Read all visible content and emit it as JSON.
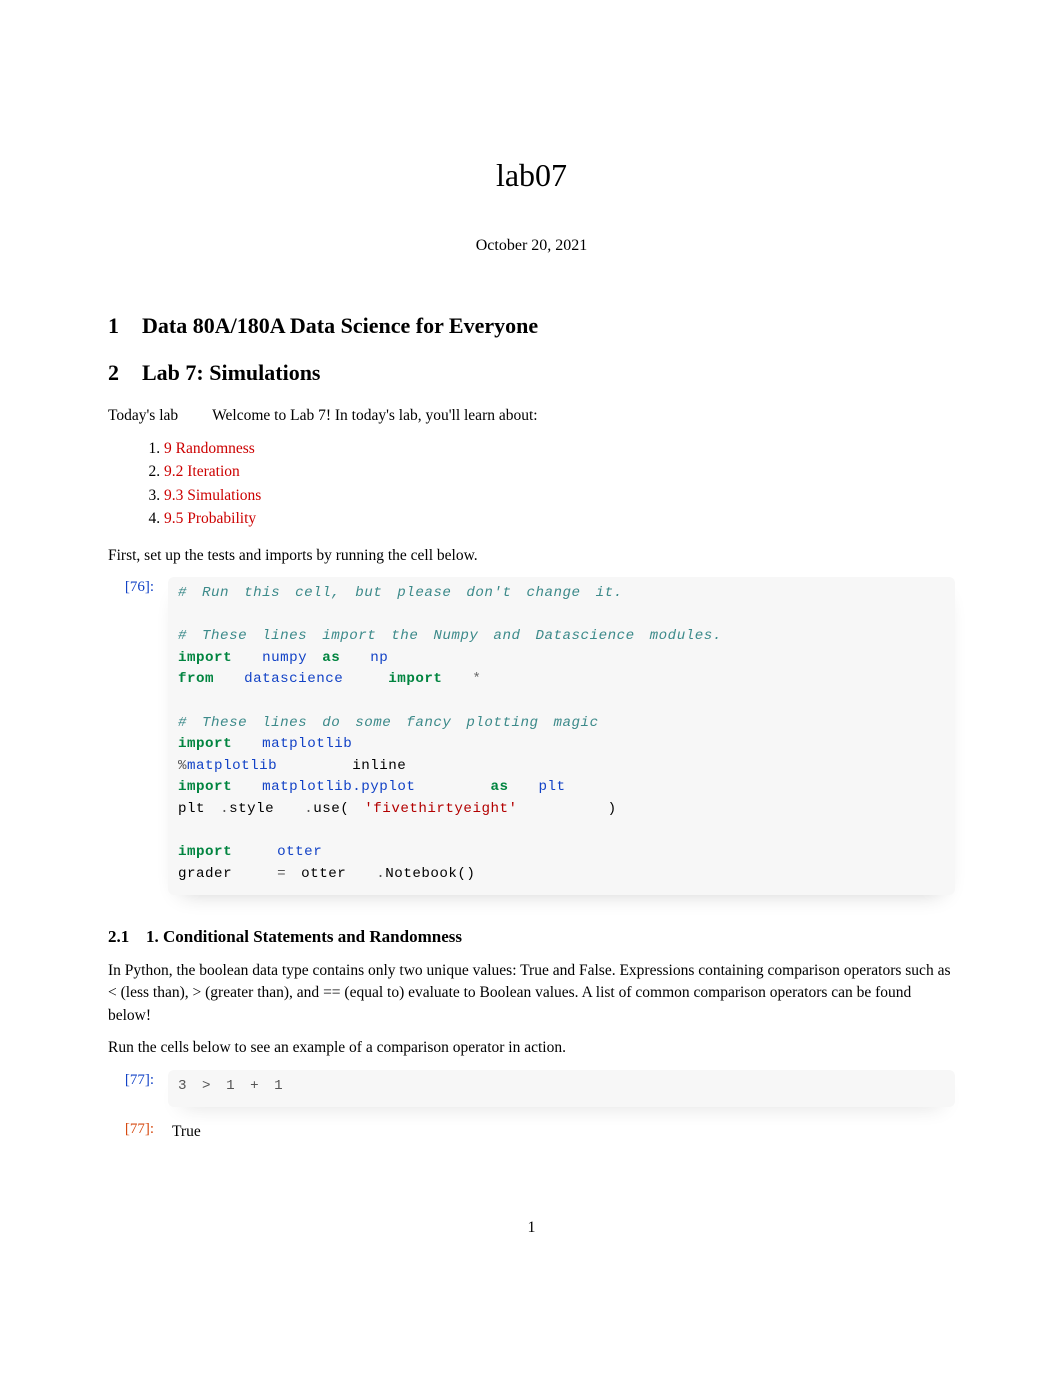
{
  "title": "lab07",
  "date": "October 20, 2021",
  "sections": {
    "s1": {
      "num": "1",
      "title": "Data 80A/180A Data Science for Everyone"
    },
    "s2": {
      "num": "2",
      "title": "Lab 7: Simulations"
    },
    "s21": {
      "num": "2.1",
      "title": "1. Conditional Statements and Randomness"
    }
  },
  "intro": {
    "run_in": "Today's lab",
    "text": "Welcome to Lab 7! In today's lab, you'll learn about:"
  },
  "links": {
    "a": "9 Randomness",
    "b": "9.2 Iteration",
    "c": "9.3 Simulations",
    "d": "9.5 Probability"
  },
  "post_links": "First, set up the tests and imports by running the cell below.",
  "cells": {
    "setup": {
      "in_label": "[76]:"
    },
    "compare": {
      "in_label": "[77]:",
      "out_label": "[77]:",
      "out_value": "True"
    }
  },
  "code": {
    "c1": "# Run this cell, but please don't change it.",
    "c2": "# These lines import the Numpy and Datascience modules.",
    "c3": "# These lines do some fancy plotting magic",
    "kw_import": "import",
    "kw_from": "from",
    "kw_as": "as",
    "numpy": "numpy",
    "np": "np",
    "datascience": "datascience",
    "star": "*",
    "matplotlib": "matplotlib",
    "inline_magic": "matplotlib",
    "inline_word": "inline",
    "pyplot": "matplotlib.pyplot",
    "plt": "plt",
    "plt2": "plt",
    "style": "style",
    "use": "use(",
    "fte": "'fivethirtyeight'",
    "rparen": ")",
    "otter": "otter",
    "grader": "grader",
    "eq": "=",
    "otter2": "otter",
    "notebook": "Notebook()",
    "dot": ".",
    "percent": "%",
    "expr_3": "3",
    "expr_gt": ">",
    "expr_1a": "1",
    "expr_plus": "+",
    "expr_1b": "1"
  },
  "paras": {
    "p1a": "In Python, the boolean data type contains only two unique values: ",
    "true": "True",
    "p1b": " and ",
    "false": "False",
    "p1c": ". Expressions containing comparison operators such as ",
    "lt": "<",
    "p1d": " (less than), ",
    "gt": ">",
    "p1e": " (greater than), and ",
    "eqeq": "==",
    "p1f": " (equal to) evaluate to Boolean values. A list of common comparison operators can be found below!",
    "p2": "Run the cells below to see an example of a comparison operator in action."
  },
  "page_number": "1"
}
